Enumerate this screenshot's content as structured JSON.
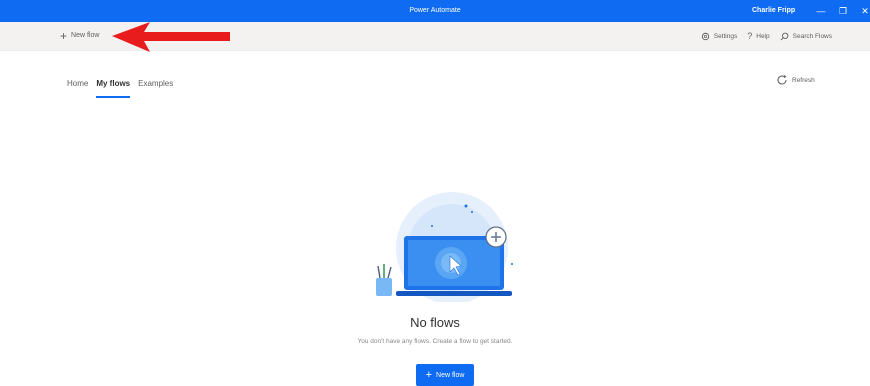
{
  "window": {
    "title": "Power Automate",
    "user": "Charlie Fripp",
    "minimize_glyph": "—",
    "restore_glyph": "❐",
    "close_glyph": "✕"
  },
  "commandbar": {
    "new_flow_label": "New flow",
    "settings_label": "Settings",
    "help_label": "Help",
    "search_placeholder": "Search Flows"
  },
  "tabs": [
    {
      "label": "Home",
      "active": false
    },
    {
      "label": "My flows",
      "active": true
    },
    {
      "label": "Examples",
      "active": false
    }
  ],
  "refresh_label": "Refresh",
  "empty_state": {
    "title": "No flows",
    "subtitle": "You don't have any flows. Create a flow to get started.",
    "button_label": "New flow"
  },
  "colors": {
    "accent": "#0f6cf2",
    "annotation_arrow": "#e81c1c"
  },
  "icons": [
    "plus-icon",
    "gear-icon",
    "help-icon",
    "search-icon",
    "refresh-icon",
    "annotation-arrow-icon",
    "laptop-illustration"
  ]
}
